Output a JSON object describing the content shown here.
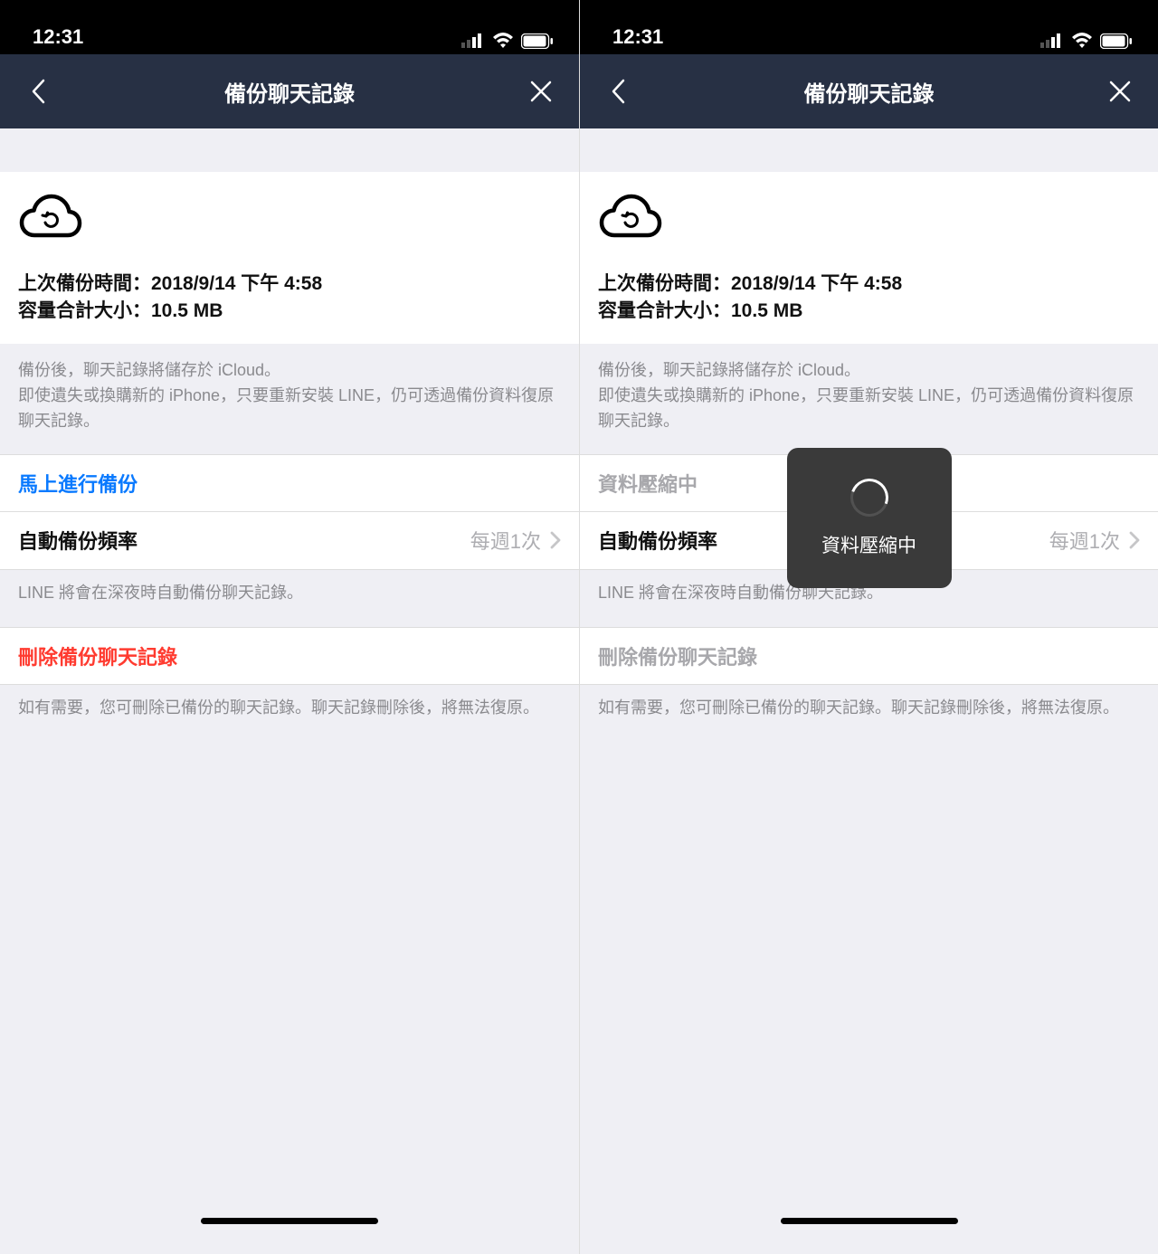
{
  "status": {
    "time": "12:31"
  },
  "nav": {
    "title": "備份聊天記錄"
  },
  "info": {
    "last_backup_label": "上次備份時間：",
    "last_backup_value": "2018/9/14 下午 4:58",
    "size_label": "容量合計大小：",
    "size_value": "10.5 MB",
    "note": "備份後，聊天記錄將儲存於 iCloud。\n即使遺失或換購新的 iPhone，只要重新安裝 LINE，仍可透過備份資料復原聊天記錄。"
  },
  "actions": {
    "backup_now": "馬上進行備份",
    "compressing": "資料壓縮中",
    "auto_freq_label": "自動備份頻率",
    "auto_freq_value": "每週1次",
    "auto_freq_note": "LINE 將會在深夜時自動備份聊天記錄。",
    "delete": "刪除備份聊天記錄",
    "delete_note": "如有需要，您可刪除已備份的聊天記錄。聊天記錄刪除後，將無法復原。"
  },
  "toast": {
    "label": "資料壓縮中"
  }
}
